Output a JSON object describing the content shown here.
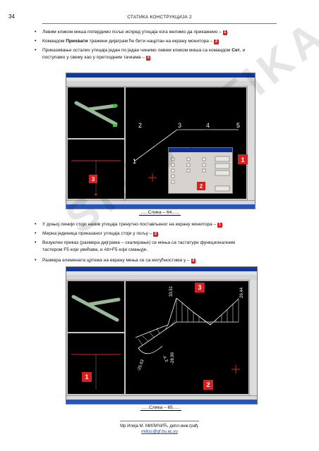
{
  "header": {
    "page_number": "34",
    "title": "СТАТИКА КОНСТРУКЦИЈА 2"
  },
  "paragraphs_top": [
    {
      "text": "Левим кликом миша потврдимо поље испред утицаја кога желимо да прикажемо – ",
      "badge": "1",
      "tail": "."
    },
    {
      "pre": "Командом ",
      "bold": "Прихвати",
      "text": " тражени дијаграм ће бити нацртан на екрану монитора – ",
      "badge": "2",
      "tail": "."
    },
    {
      "text": "Приказивање осталих утицаја један по један чинимо левим кликом миша са командом ",
      "bold": "Сет",
      "tail2": ", и",
      "line2": "поступамо у свему као у претходним тачкама – ",
      "badge": "3",
      "tail": "."
    }
  ],
  "figure1": {
    "caption": "…..Слика – 64…..",
    "node_labels": [
      "1",
      "2",
      "3",
      "4",
      "5"
    ],
    "markers": [
      "1",
      "2",
      "3"
    ]
  },
  "paragraphs_bottom": [
    {
      "text": "У доњој линији стоји назив утицаја тренутно постављеног на екрану монитора – ",
      "badge": "1",
      "tail": "."
    },
    {
      "text": "Мерна јединица приказаног утицаја стоји у пољу – ",
      "badge": "2",
      "tail": "."
    },
    {
      "text": "Визуелни приказ (размера дијграма – скалирање) се мења са тастатуре функционалним",
      "line2": "тастером F5 који увећава, и Alt+F5 који смањује."
    },
    {
      "text": "Размера елемената цртежа на екрану мења се са могућностима у – ",
      "badge": "3",
      "tail": "."
    }
  ],
  "figure2": {
    "caption": "…..Слика – 65…..",
    "diagram_values": [
      "33.51",
      "29.44",
      "-25.63",
      "-28.99",
      "-4.3"
    ],
    "markers": [
      "1",
      "2",
      "3"
    ]
  },
  "watermark": "SIMSTATIKA",
  "footer": {
    "author": "Мр Илија М. МИЛИЧИЋ, дипл.инж.грађ.",
    "email": "milicic@gf.bu.ac.yu"
  }
}
